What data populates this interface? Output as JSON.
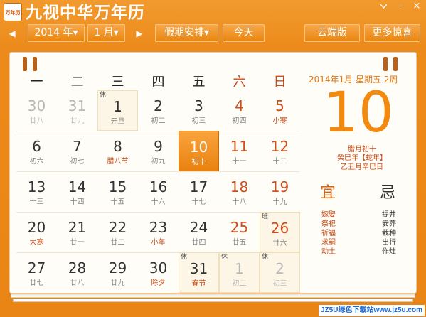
{
  "app": {
    "icon_text": "万年历",
    "title": "九视中华万年历",
    "menu_icon": "chevron-down-icon",
    "minimize": "-",
    "close": "×"
  },
  "toolbar": {
    "prev": "◀",
    "next": "▶",
    "year": "2014 年▾",
    "month": "1 月▾",
    "holiday": "假期安排▾",
    "today": "今天",
    "cloud": "云端版",
    "more": "更多惊喜"
  },
  "weekdays": [
    "一",
    "二",
    "三",
    "四",
    "五",
    "六",
    "日"
  ],
  "weeks": [
    [
      {
        "day": "30",
        "lunar": "廿八",
        "dim": true
      },
      {
        "day": "31",
        "lunar": "廿九",
        "dim": true
      },
      {
        "day": "1",
        "lunar": "元旦",
        "holiday": true,
        "tag": "休"
      },
      {
        "day": "2",
        "lunar": "初二"
      },
      {
        "day": "3",
        "lunar": "初三"
      },
      {
        "day": "4",
        "lunar": "初四",
        "red": true
      },
      {
        "day": "5",
        "lunar": "小寒",
        "red": true,
        "lunar_red": true
      }
    ],
    [
      {
        "day": "6",
        "lunar": "初六"
      },
      {
        "day": "7",
        "lunar": "初七"
      },
      {
        "day": "8",
        "lunar": "腊八节",
        "lunar_red": true
      },
      {
        "day": "9",
        "lunar": "初九"
      },
      {
        "day": "10",
        "lunar": "初十",
        "selected": true
      },
      {
        "day": "11",
        "lunar": "十一",
        "red": true
      },
      {
        "day": "12",
        "lunar": "十二",
        "red": true
      }
    ],
    [
      {
        "day": "13",
        "lunar": "十三"
      },
      {
        "day": "14",
        "lunar": "十四"
      },
      {
        "day": "15",
        "lunar": "十五"
      },
      {
        "day": "16",
        "lunar": "十六"
      },
      {
        "day": "17",
        "lunar": "十七"
      },
      {
        "day": "18",
        "lunar": "十八",
        "red": true
      },
      {
        "day": "19",
        "lunar": "十九",
        "red": true
      }
    ],
    [
      {
        "day": "20",
        "lunar": "大寒",
        "lunar_red": true
      },
      {
        "day": "21",
        "lunar": "廿一"
      },
      {
        "day": "22",
        "lunar": "廿二"
      },
      {
        "day": "23",
        "lunar": "小年",
        "lunar_red": true
      },
      {
        "day": "24",
        "lunar": "廿四"
      },
      {
        "day": "25",
        "lunar": "廿五",
        "red": true
      },
      {
        "day": "26",
        "lunar": "廿六",
        "red": true,
        "tag": "班",
        "workday": true
      }
    ],
    [
      {
        "day": "27",
        "lunar": "廿七"
      },
      {
        "day": "28",
        "lunar": "廿八"
      },
      {
        "day": "29",
        "lunar": "廿九"
      },
      {
        "day": "30",
        "lunar": "除夕",
        "lunar_red": true
      },
      {
        "day": "31",
        "lunar": "春节",
        "holiday": true,
        "tag": "休",
        "lunar_red": true
      },
      {
        "day": "1",
        "lunar": "初二",
        "holiday": true,
        "tag": "休",
        "dim": true
      },
      {
        "day": "2",
        "lunar": "初三",
        "holiday": true,
        "tag": "休",
        "dim": true
      }
    ]
  ],
  "info": {
    "date_line": "2014年1月   星期五  2周",
    "big_day": "10",
    "lunar_month_day": "腊月初十",
    "ganzhi_year": "癸巳年【蛇年】",
    "ganzhi_month_day": "乙丑月辛巳日",
    "yi_title": "宜",
    "ji_title": "忌",
    "yi_items": [
      "嫁娶",
      "祭祀",
      "祈福",
      "求嗣",
      "动土"
    ],
    "ji_items": [
      "提井",
      "安葬",
      "栽种",
      "出行",
      "作灶"
    ]
  },
  "watermark": "JZ5U绿色下载站www.jz5u.com",
  "colors": {
    "brand_orange": "#e98514",
    "accent_red": "#cf4f1a",
    "selected_cell": "#f28a10"
  }
}
